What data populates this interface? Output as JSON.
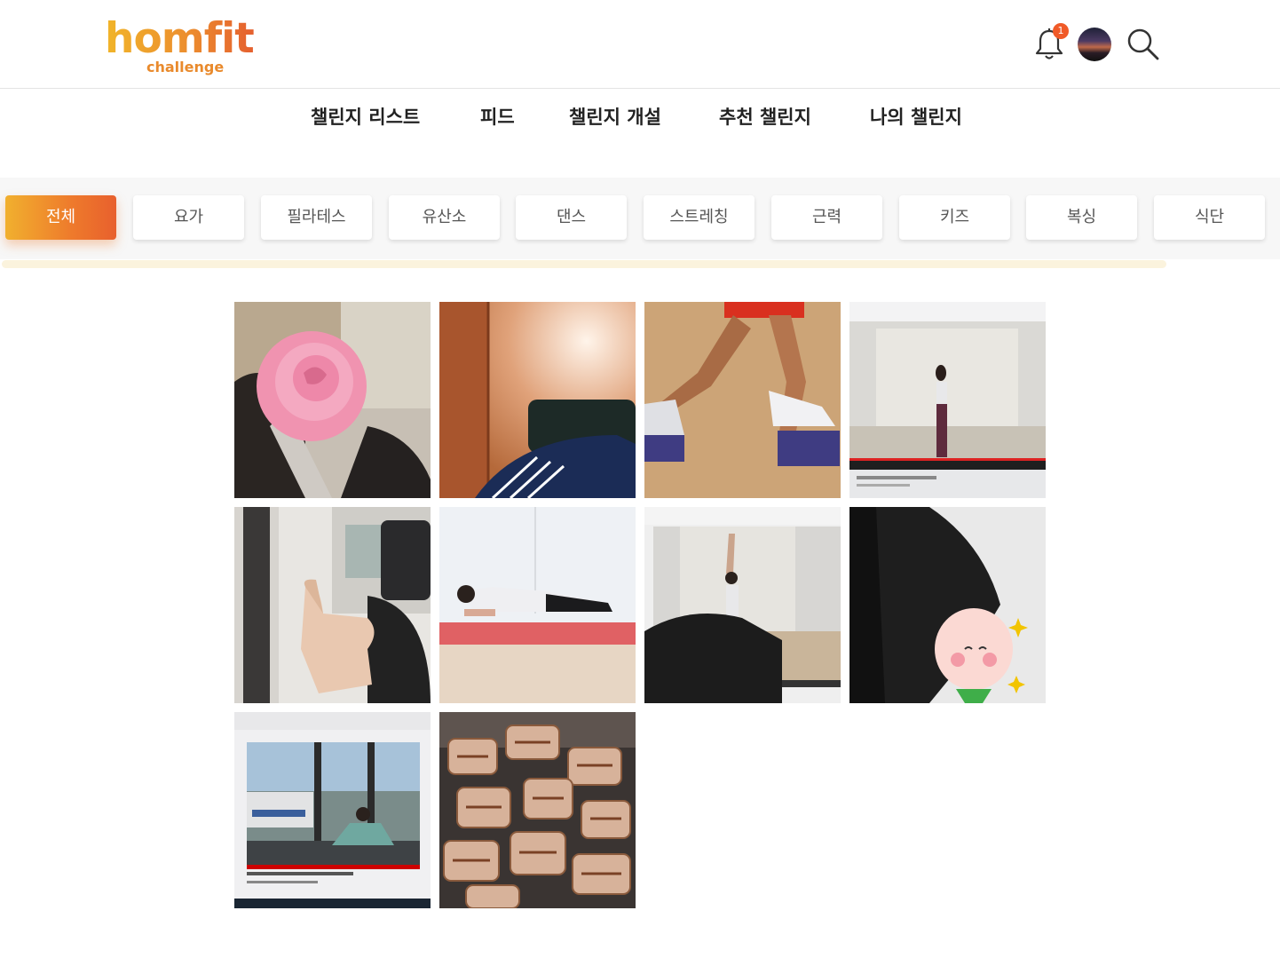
{
  "brand": {
    "logo_main": "homfit",
    "logo_sub": "challenge",
    "gradient": [
      "#f1b52a",
      "#e5602f"
    ]
  },
  "header": {
    "notification_count": "1",
    "icons": [
      "bell-icon",
      "avatar",
      "search-icon"
    ]
  },
  "nav": {
    "items": [
      {
        "label": "챌린지 리스트"
      },
      {
        "label": "피드"
      },
      {
        "label": "챌린지 개설"
      },
      {
        "label": "추천 챌린지"
      },
      {
        "label": "나의 챌린지"
      }
    ]
  },
  "categories": {
    "active_index": 0,
    "active_color": "#ee7a2c",
    "items": [
      {
        "label": "전체"
      },
      {
        "label": "요가"
      },
      {
        "label": "필라테스"
      },
      {
        "label": "유산소"
      },
      {
        "label": "댄스"
      },
      {
        "label": "스트레칭"
      },
      {
        "label": "근력"
      },
      {
        "label": "키즈"
      },
      {
        "label": "복싱"
      },
      {
        "label": "식단"
      }
    ]
  },
  "feed": {
    "thumbnails": [
      {
        "subject": "rose-covered-selfie"
      },
      {
        "subject": "office-chair-tracksuit"
      },
      {
        "subject": "legs-lunge-sneakers"
      },
      {
        "subject": "video-screen-standing-woman"
      },
      {
        "subject": "thumbs-up-selfie"
      },
      {
        "subject": "plank-on-mat"
      },
      {
        "subject": "video-screen-stretch"
      },
      {
        "subject": "black-jacket-sticker"
      },
      {
        "subject": "laptop-yoga-video"
      },
      {
        "subject": "grilled-pork-belly"
      }
    ]
  }
}
